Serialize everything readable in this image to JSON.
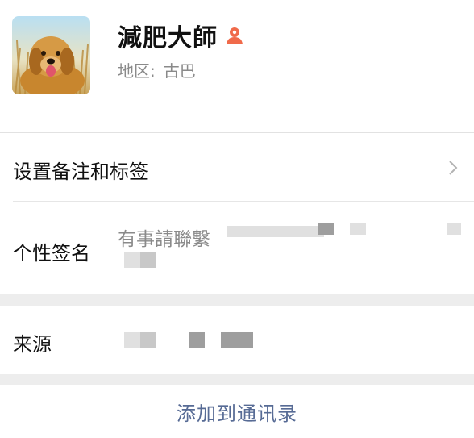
{
  "profile": {
    "name": "減肥大師",
    "gender_icon": "female-person-icon",
    "region_label": "地区:",
    "region_value": "古巴",
    "avatar": "golden-retriever-photo"
  },
  "rows": {
    "remark_label": "设置备注和标签",
    "signature_label": "个性签名",
    "signature_text": "有事請聯繫",
    "source_label": "来源"
  },
  "actions": {
    "add_contact": "添加到通讯录"
  },
  "colors": {
    "link": "#576b95",
    "gender_icon": "#f06a4a",
    "secondary_text": "#8a8a8a"
  }
}
